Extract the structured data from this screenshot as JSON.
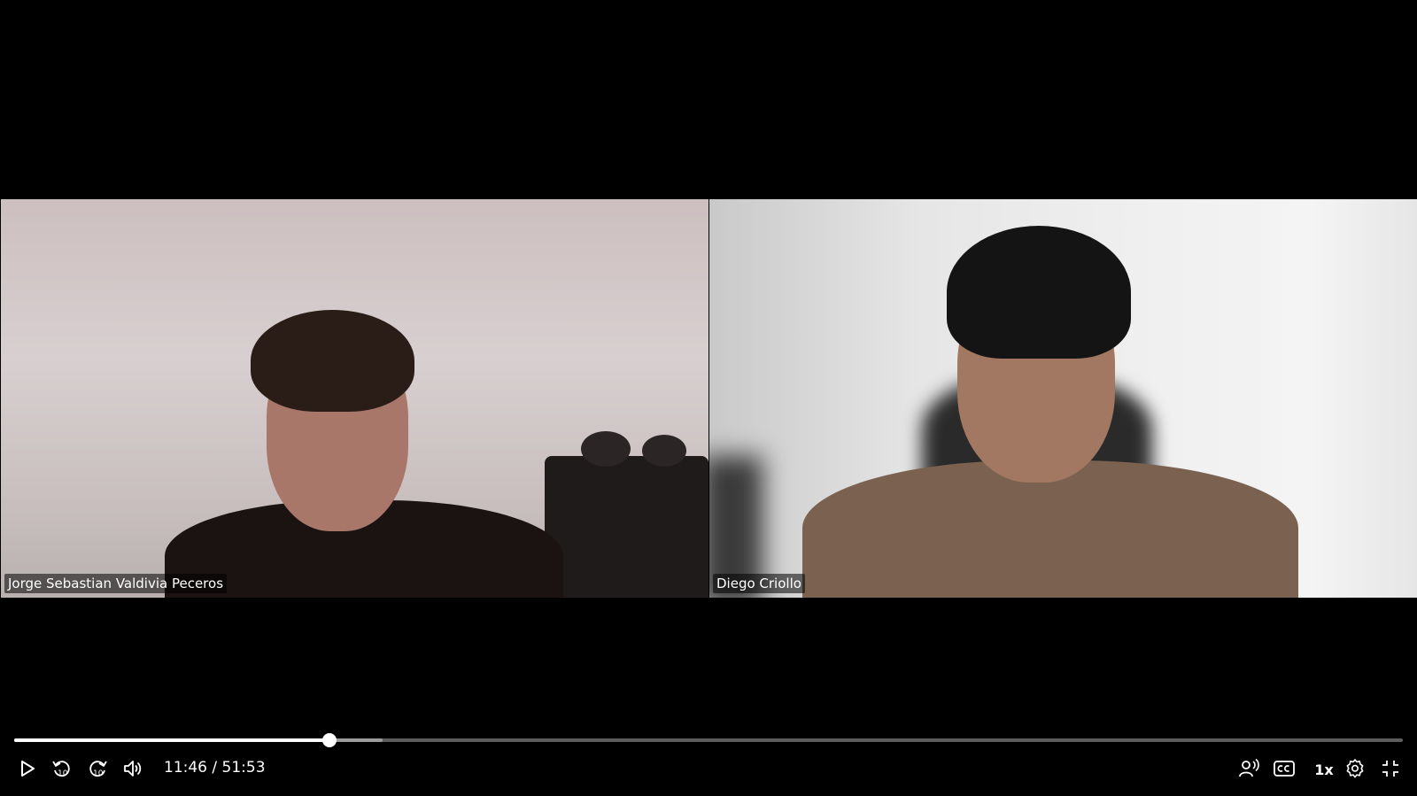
{
  "participants": [
    {
      "name": "Jorge Sebastian Valdivia Peceros"
    },
    {
      "name": "Diego Criollo"
    }
  ],
  "player": {
    "current_time": "11:46",
    "separator": " / ",
    "duration": "51:53",
    "played_fraction": 0.2268,
    "buffered_fraction": 0.2655,
    "speed_label": "1x",
    "skip_back_seconds": "10",
    "skip_forward_seconds": "10"
  },
  "icons": {
    "play": "play-icon",
    "rewind": "rewind-10-icon",
    "forward": "forward-10-icon",
    "volume": "volume-icon",
    "audio_description": "audio-description-icon",
    "captions": "closed-captions-icon",
    "settings": "gear-icon",
    "fullscreen": "exit-fullscreen-icon"
  },
  "colors": {
    "background": "#000000",
    "progress_played": "#ffffff",
    "progress_buffered": "#9b9b9b",
    "progress_track": "#5d5d5d"
  }
}
